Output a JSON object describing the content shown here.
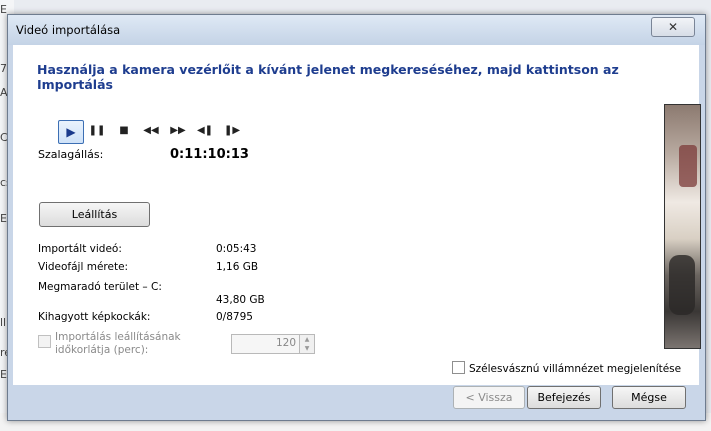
{
  "window": {
    "title": "Videó importálása",
    "close_glyph": "✕"
  },
  "heading": "Használja a kamera vezérlőit a kívánt jelenet megkereséséhez, majd kattintson az Importálás",
  "transport": {
    "play": "▶",
    "pause": "❚❚",
    "stop": "■",
    "rewind": "◀◀",
    "fast_forward": "▶▶",
    "step_back": "◀❚",
    "step_forward": "❚▶"
  },
  "tape": {
    "label": "Szalagállás:",
    "value": "0:11:10:13"
  },
  "stop_button": "Leállítás",
  "stats": [
    {
      "label": "Importált videó:",
      "value": "0:05:43"
    },
    {
      "label": "Videofájl mérete:",
      "value": "1,16 GB"
    },
    {
      "label": "Megmaradó terület – C:",
      "value": "43,80 GB"
    },
    {
      "label": "Kihagyott képkockák:",
      "value": "0/8795"
    }
  ],
  "timeout": {
    "label": "Importálás leállításának időkorlátja (perc):",
    "value": "120",
    "checked": false,
    "enabled": false
  },
  "widescreen": {
    "label": "Szélesvásznú villámnézet megjelenítése",
    "checked": false
  },
  "buttons": {
    "back": "< Vissza",
    "finish": "Befejezés",
    "cancel": "Mégse"
  },
  "background": {
    "left_edge": [
      "E",
      "7",
      "A",
      "Ci",
      "cs",
      "Er",
      "ll",
      "re",
      "En"
    ]
  }
}
